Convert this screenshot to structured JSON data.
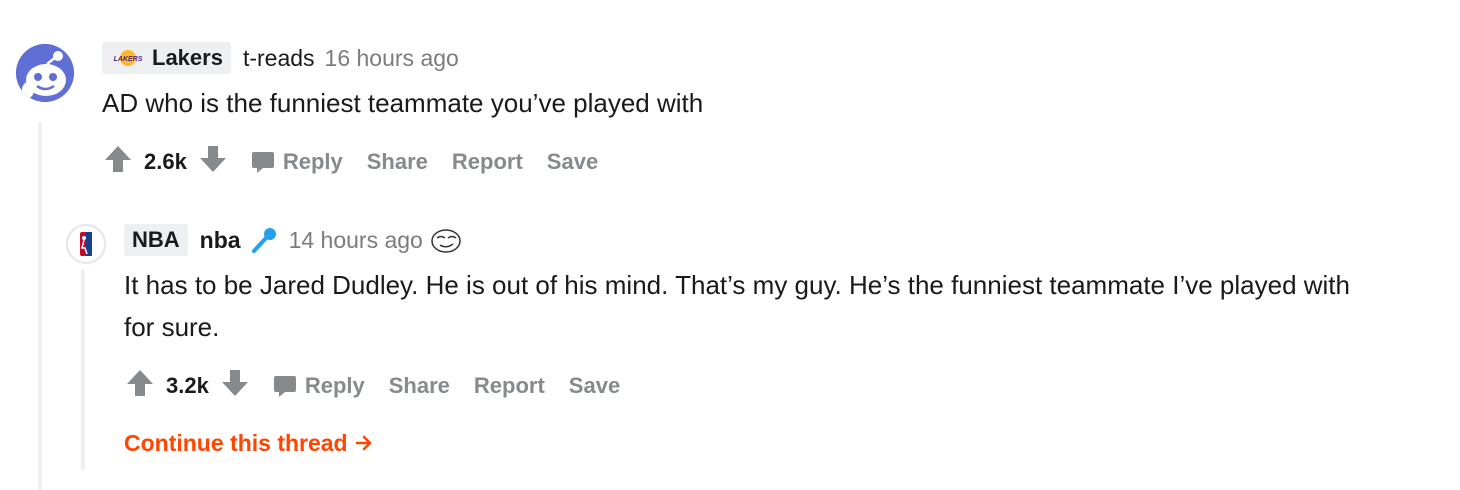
{
  "comment_top": {
    "flair": "Lakers",
    "flair_badge_text": "LAKERS",
    "author": "t-reads",
    "time": "16 hours ago",
    "body": "AD who is the funniest teammate you’ve played with",
    "score": "2.6k",
    "actions": {
      "reply": "Reply",
      "share": "Share",
      "report": "Report",
      "save": "Save"
    }
  },
  "comment_reply": {
    "flair": "NBA",
    "author": "nba",
    "time": "14 hours ago",
    "body": "It has to be Jared Dudley. He is out of his mind. That’s my guy. He’s the funniest teammate I’ve played with for sure.",
    "score": "3.2k",
    "actions": {
      "reply": "Reply",
      "share": "Share",
      "report": "Report",
      "save": "Save"
    }
  },
  "continue_thread": "Continue this thread",
  "colors": {
    "accent": "#ff4500",
    "muted": "#878a8c",
    "thread_line": "#edeff1",
    "mic_blue": "#24a0ed"
  },
  "icons": [
    "snoo-avatar-icon",
    "lakers-logo-icon",
    "nba-logo-icon",
    "microphone-icon",
    "award-icon",
    "upvote-icon",
    "downvote-icon",
    "comment-icon",
    "arrow-right-icon"
  ]
}
